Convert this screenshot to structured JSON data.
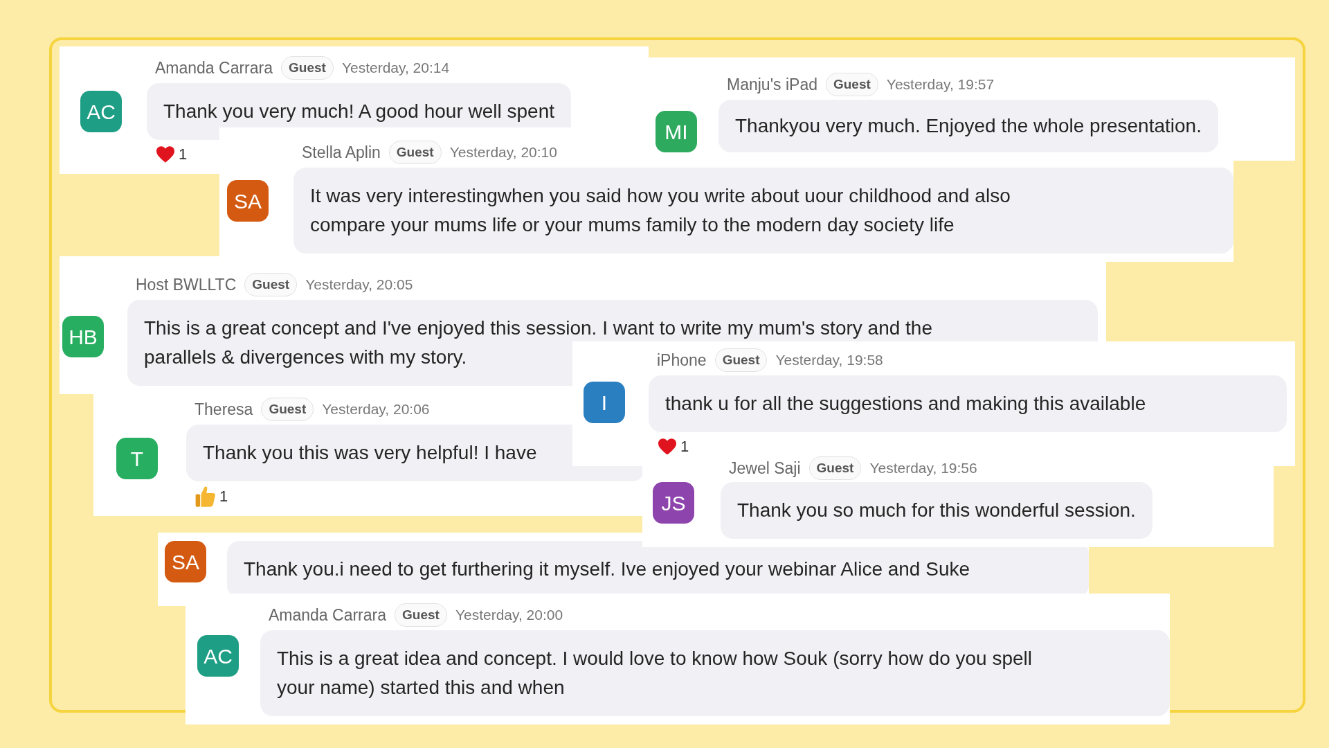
{
  "messages": [
    {
      "initials": "AC",
      "color": "#1e9e85",
      "sender": "Amanda Carrara",
      "badge": "Guest",
      "time": "Yesterday, 20:14",
      "lines": [
        "Thank you very much! A good hour well spent"
      ],
      "reactions": [
        {
          "kind": "heart",
          "count": "1"
        }
      ]
    },
    {
      "initials": "SA",
      "color": "#d45a12",
      "sender": "Stella Aplin",
      "badge": "Guest",
      "time": "Yesterday, 20:10",
      "lines": [
        "It was very interestingwhen you said how you write about uour childhood and also",
        "compare your mums life or your mums family to the modern day society life"
      ]
    },
    {
      "initials": "MI",
      "color": "#2eaa5e",
      "sender": "Manju's iPad",
      "badge": "Guest",
      "time": "Yesterday, 19:57",
      "lines": [
        "Thankyou very much. Enjoyed the whole presentation."
      ]
    },
    {
      "initials": "HB",
      "color": "#27ae60",
      "sender": "Host BWLLTC",
      "badge": "Guest",
      "time": "Yesterday, 20:05",
      "lines": [
        "This is a great concept and I've enjoyed this session. I want to write my mum's story and the",
        "parallels & divergences with my story."
      ]
    },
    {
      "initials": "T",
      "color": "#27ae60",
      "sender": "Theresa",
      "badge": "Guest",
      "time": "Yesterday, 20:06",
      "lines": [
        "Thank you this was very helpful! I have"
      ],
      "reactions": [
        {
          "kind": "thumbs-up",
          "count": "1"
        }
      ]
    },
    {
      "initials": "SA",
      "color": "#d45a12",
      "lines": [
        "Thank you.i need to get furthering it myself. Ive enjoyed your webinar Alice and Suke"
      ]
    },
    {
      "initials": "I",
      "color": "#2a7fc1",
      "sender": "iPhone",
      "badge": "Guest",
      "time": "Yesterday, 19:58",
      "lines": [
        "thank u for all the suggestions and making this available"
      ],
      "reactions": [
        {
          "kind": "heart",
          "count": "1"
        }
      ]
    },
    {
      "initials": "JS",
      "color": "#8e44ad",
      "sender": "Jewel Saji",
      "badge": "Guest",
      "time": "Yesterday, 19:56",
      "lines": [
        "Thank you so much for this wonderful session."
      ]
    },
    {
      "initials": "AC",
      "color": "#1e9e85",
      "sender": "Amanda Carrara",
      "badge": "Guest",
      "time": "Yesterday, 20:00",
      "lines": [
        "This is a great idea and concept. I would love to know how Souk (sorry how do you spell",
        "your name) started this and when"
      ]
    }
  ]
}
